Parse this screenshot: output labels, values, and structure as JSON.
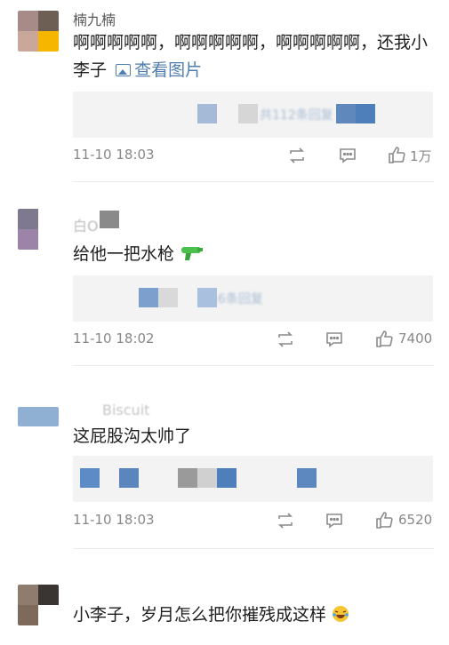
{
  "comments": [
    {
      "username": "楠九楠",
      "text": "啊啊啊啊啊，啊啊啊啊啊，啊啊啊啊啊，还我小李子",
      "view_picture": "查看图片",
      "reply_summary": "共112条回复",
      "time": "11-10 18:03",
      "likes": "1万"
    },
    {
      "username": "白O",
      "text": "给他一把水枪",
      "emoji": "water-gun-icon",
      "reply_summary": "共16条回复",
      "time": "11-10 18:02",
      "likes": "7400"
    },
    {
      "username": "Biscuit",
      "text": "这屁股沟太帅了",
      "time": "11-10 18:03",
      "likes": "6520"
    },
    {
      "text": "小李子，岁月怎么把你摧残成这样",
      "emoji": "laugh-cry-icon"
    }
  ],
  "colors": {
    "link": "#507daf",
    "meta": "#888888",
    "reply_bg": "#f3f3f3"
  }
}
